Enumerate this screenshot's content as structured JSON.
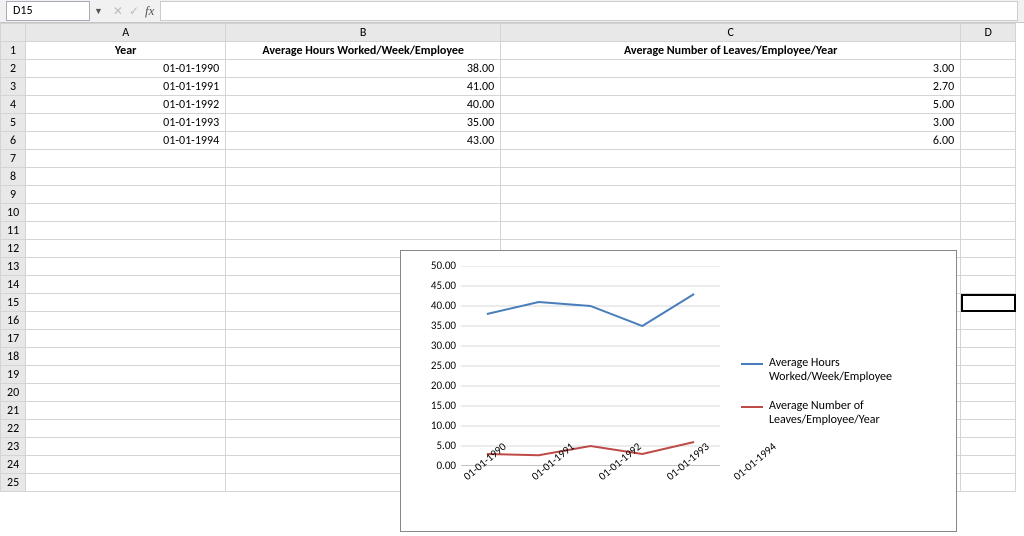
{
  "namebox": "D15",
  "fx_label": "fx",
  "formula": "",
  "columns": [
    "",
    "A",
    "B",
    "C",
    "D"
  ],
  "selected_col": "D",
  "selected_row": 15,
  "headers": {
    "A": "Year",
    "B": "Average Hours Worked/Week/Employee",
    "C": "Average Number of Leaves/Employee/Year"
  },
  "rows": [
    {
      "A": "01-01-1990",
      "B": "38.00",
      "C": "3.00"
    },
    {
      "A": "01-01-1991",
      "B": "41.00",
      "C": "2.70"
    },
    {
      "A": "01-01-1992",
      "B": "40.00",
      "C": "5.00"
    },
    {
      "A": "01-01-1993",
      "B": "35.00",
      "C": "3.00"
    },
    {
      "A": "01-01-1994",
      "B": "43.00",
      "C": "6.00"
    }
  ],
  "row_count": 25,
  "chart_data": {
    "type": "line",
    "categories": [
      "01-01-1990",
      "01-01-1991",
      "01-01-1992",
      "01-01-1993",
      "01-01-1994"
    ],
    "series": [
      {
        "name": "Average Hours Worked/Week/Employee",
        "color": "#4a7ebb",
        "values": [
          38.0,
          41.0,
          40.0,
          35.0,
          43.0
        ]
      },
      {
        "name": "Average Number of Leaves/Employee/Year",
        "color": "#be4b48",
        "values": [
          3.0,
          2.7,
          5.0,
          3.0,
          6.0
        ]
      }
    ],
    "ylim": [
      0,
      50
    ],
    "ystep": 5,
    "yticks": [
      "0.00",
      "5.00",
      "10.00",
      "15.00",
      "20.00",
      "25.00",
      "30.00",
      "35.00",
      "40.00",
      "45.00",
      "50.00"
    ]
  }
}
